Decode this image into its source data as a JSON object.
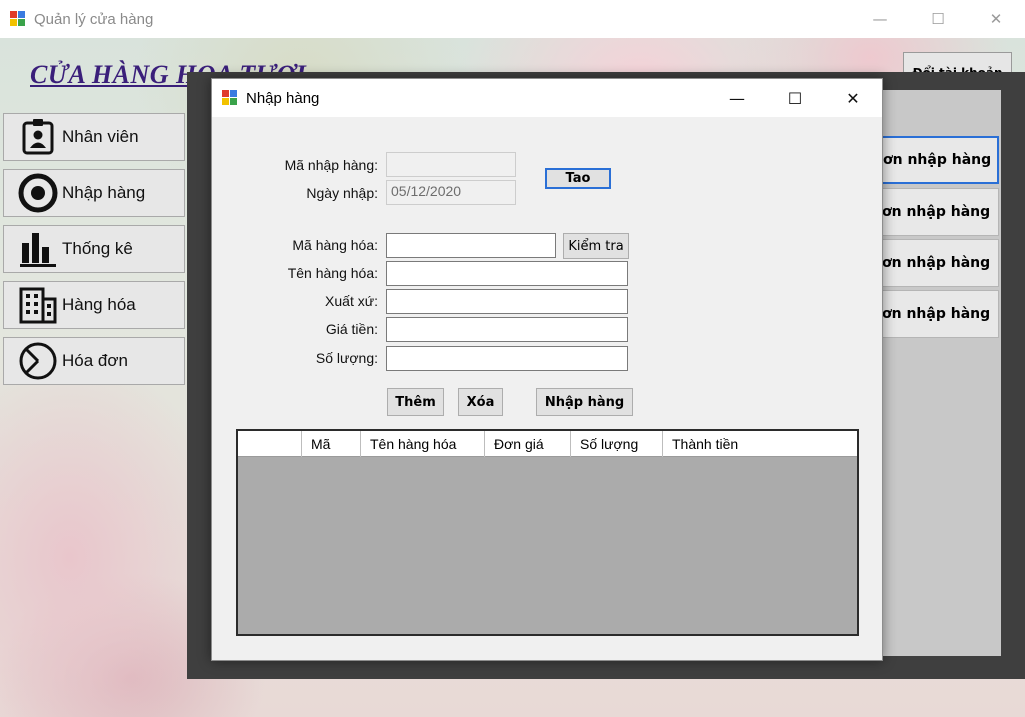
{
  "main_window": {
    "title": "Quản lý cửa hàng",
    "controls": {
      "minimize": "—",
      "maximize": "☐",
      "close": "✕"
    }
  },
  "header": {
    "shop_title": "CỬA HÀNG HOA TƯƠI",
    "switch_account": "Đổi tài khoản"
  },
  "sidebar": {
    "items": [
      {
        "label": "Nhân viên",
        "icon": "employee-badge-icon"
      },
      {
        "label": "Nhập hàng",
        "icon": "target-icon"
      },
      {
        "label": "Thống kê",
        "icon": "bar-chart-icon"
      },
      {
        "label": "Hàng hóa",
        "icon": "building-icon"
      },
      {
        "label": "Hóa đơn",
        "icon": "pie-chart-icon"
      }
    ]
  },
  "right_panel": {
    "buttons": [
      {
        "label": "ơn nhập hàng"
      },
      {
        "label": "ơn nhập hàng"
      },
      {
        "label": "ơn nhập hàng"
      },
      {
        "label": "ơn nhập hàng"
      }
    ]
  },
  "dialog": {
    "title": "Nhập hàng",
    "controls": {
      "minimize": "—",
      "maximize": "☐",
      "close": "✕"
    },
    "fields": {
      "ma_nhap_hang": {
        "label": "Mã nhập hàng:",
        "value": ""
      },
      "ngay_nhap": {
        "label": "Ngày nhập:",
        "value": "05/12/2020"
      },
      "ma_hang_hoa": {
        "label": "Mã hàng hóa:",
        "value": ""
      },
      "ten_hang_hoa": {
        "label": "Tên hàng hóa:",
        "value": ""
      },
      "xuat_xu": {
        "label": "Xuất xứ:",
        "value": ""
      },
      "gia_tien": {
        "label": "Giá tiền:",
        "value": ""
      },
      "so_luong": {
        "label": "Số lượng:",
        "value": ""
      }
    },
    "buttons": {
      "tao": "Tao",
      "kiem_tra": "Kiểm tra",
      "them": "Thêm",
      "xoa": "Xóa",
      "nhap_hang": "Nhập hàng"
    },
    "grid": {
      "columns": [
        "",
        "Mã",
        "Tên hàng hóa",
        "Đơn giá",
        "Số lượng",
        "Thành tiền"
      ],
      "rows": []
    }
  },
  "colors": {
    "accent_focus": "#2a6fd6",
    "title_purple": "#3a1f7a",
    "dark_panel": "#3f3f3f"
  }
}
